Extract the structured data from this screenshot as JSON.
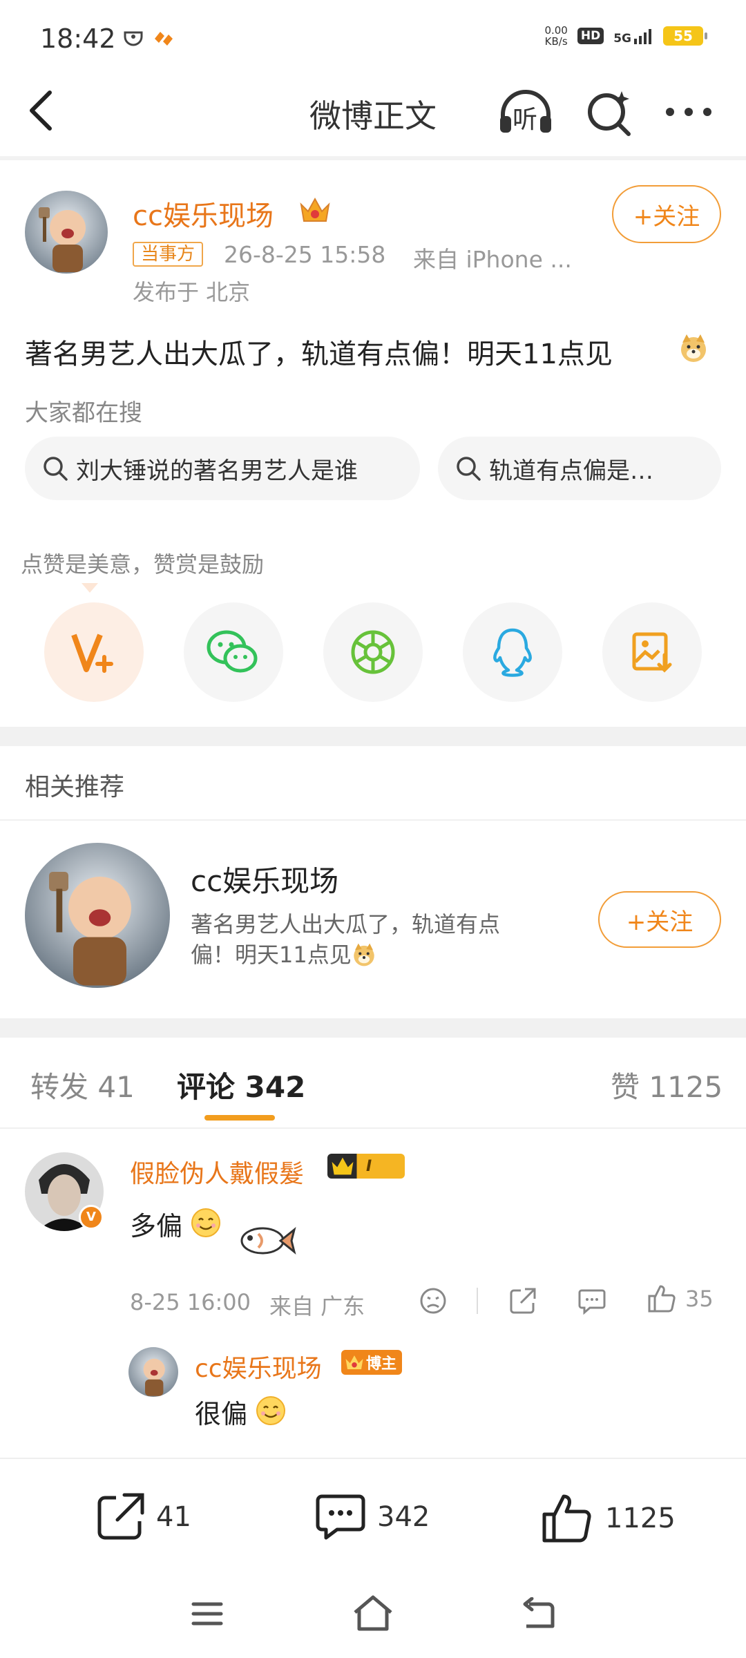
{
  "status_bar": {
    "time": "18:42",
    "net_speed_value": "0.00",
    "net_speed_unit": "KB/s",
    "hd_label": "HD",
    "signal_label": "5G",
    "battery": "55"
  },
  "header": {
    "title": "微博正文",
    "back_icon": "back-arrow-icon",
    "listen_label": "听",
    "search_icon": "search-sparkle-icon",
    "more_icon": "more-dots-icon"
  },
  "post": {
    "author": "cc娱乐现场",
    "tag": "当事方",
    "time": "26-8-25 15:58",
    "source": "来自 iPhone ...",
    "location": "发布于 北京",
    "follow_label": "+关注",
    "text": "著名男艺人出大瓜了，轨道有点偏！明天11点见",
    "search_section_label": "大家都在搜",
    "searches": [
      "刘大锤说的著名男艺人是谁",
      "轨道有点偏是…"
    ],
    "reward_hint": "点赞是美意，赞赏是鼓励"
  },
  "recommend": {
    "section_title": "相关推荐",
    "name": "cc娱乐现场",
    "desc_line1": "著名男艺人出大瓜了，轨道有点",
    "desc_line2": "偏！明天11点见",
    "follow_label": "+关注"
  },
  "tabs": {
    "repost": "转发 41",
    "comments": "评论 342",
    "likes": "赞 1125"
  },
  "comments": [
    {
      "user": "假脸伪人戴假髮",
      "badge_level": "I",
      "text": "多偏",
      "time": "8-25 16:00",
      "from": "来自 广东",
      "likes": "35"
    }
  ],
  "reply": {
    "user": "cc娱乐现场",
    "badge": "博主",
    "text": "很偏"
  },
  "bottom_bar": {
    "reposts": "41",
    "comments": "342",
    "likes": "1125"
  },
  "colors": {
    "accent": "#f0861a",
    "name_orange": "#e8761a",
    "wechat": "#33c25a",
    "moments": "#67c23a",
    "qq": "#2aa9e0",
    "save": "#f0a020"
  }
}
